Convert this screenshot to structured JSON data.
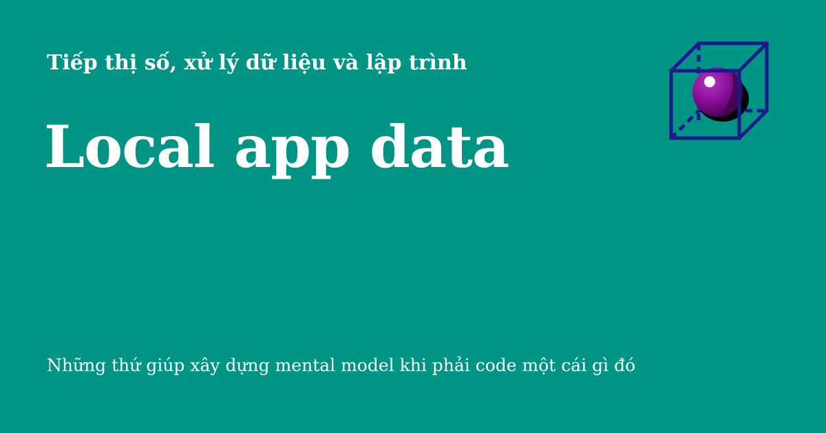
{
  "header": {
    "subtitle": "Tiếp thị số, xử lý dữ liệu và lập trình"
  },
  "main": {
    "title": "Local app data",
    "description": "Những thứ giúp xây dựng mental model khi phải code một cái gì đó"
  },
  "logo": {
    "icon": "cube-with-sphere-icon",
    "colors": {
      "cube_stroke": "#1a1a8c",
      "sphere": "#8a0f9a",
      "sphere_shadow": "#000000",
      "highlight": "#ffffff"
    }
  },
  "colors": {
    "background": "#009485",
    "text": "#ffffff"
  }
}
